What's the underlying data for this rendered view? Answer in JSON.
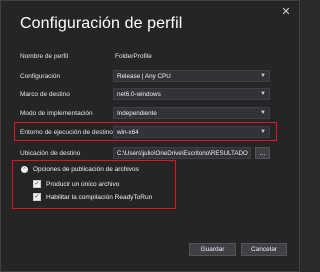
{
  "dialog": {
    "title": "Configuración de perfil",
    "close_glyph": "✕"
  },
  "fields": {
    "profile_name": {
      "label": "Nombre de perfil",
      "value": "FolderProfile"
    },
    "configuration": {
      "label": "Configuración",
      "value": "Release | Any CPU"
    },
    "target_framework": {
      "label": "Marco de destino",
      "value": "net6.0-windows"
    },
    "deployment_mode": {
      "label": "Modo de implementación",
      "value": "Independiente"
    },
    "target_runtime": {
      "label": "Entorno de ejecución de destino",
      "value": "win-x64"
    },
    "target_location": {
      "label": "Ubicación de destino",
      "value": "C:\\Users\\julio\\OneDrive\\Escritorio\\RESULTADO",
      "browse_label": "..."
    }
  },
  "file_publish_options": {
    "header": "Opciones de publicación de archivos",
    "expander_glyph": "⌃",
    "options": [
      {
        "label": "Producir un único archivo",
        "checked": true,
        "check_glyph": "✓"
      },
      {
        "label": "Habilitar la compilación ReadyToRun",
        "checked": true,
        "check_glyph": "✓"
      }
    ]
  },
  "footer": {
    "save_label": "Guardar",
    "cancel_label": "Cancelar"
  },
  "colors": {
    "highlight": "#e81123",
    "background": "#252526",
    "control": "#333337"
  }
}
